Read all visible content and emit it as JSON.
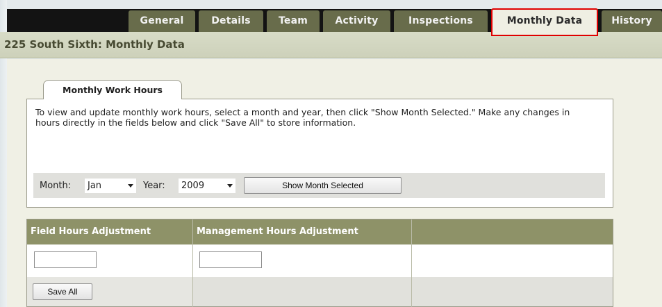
{
  "nav": {
    "tabs": [
      {
        "label": "General"
      },
      {
        "label": "Details"
      },
      {
        "label": "Team"
      },
      {
        "label": "Activity"
      },
      {
        "label": "Inspections"
      },
      {
        "label": "Monthly Data",
        "active": true
      },
      {
        "label": "History"
      }
    ]
  },
  "page": {
    "title": "225 South Sixth: Monthly Data"
  },
  "panel": {
    "tab_label": "Monthly Work Hours",
    "instructions": "To view and update monthly work hours, select a month and year, then click \"Show Month Selected.\" Make any changes in hours directly in the fields below and click \"Save All\" to store information.",
    "month_label": "Month:",
    "month_value": "Jan",
    "year_label": "Year:",
    "year_value": "2009",
    "show_button": "Show Month Selected"
  },
  "hours_table": {
    "columns": [
      "Field Hours Adjustment",
      "Management Hours Adjustment",
      ""
    ],
    "field_hours_value": "",
    "management_hours_value": "",
    "save_button": "Save All"
  },
  "colors": {
    "nav_bar": "#131313",
    "tab": "#686c4b",
    "active_tab_highlight": "#e00000",
    "table_header": "#8e9268"
  }
}
